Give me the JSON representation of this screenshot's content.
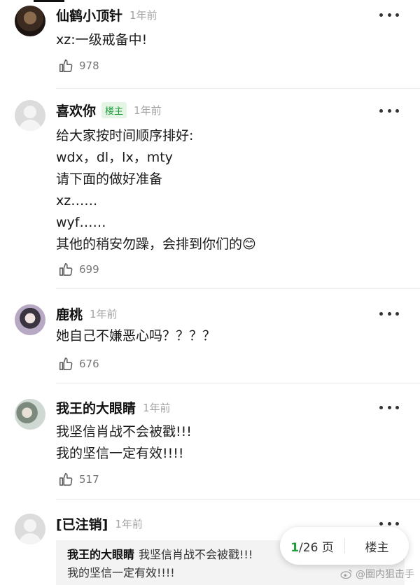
{
  "comments": [
    {
      "name": "仙鹤小顶针",
      "time": "1年前",
      "lines": [
        "xz:一级戒备中!"
      ],
      "likes": "978"
    },
    {
      "name": "喜欢你",
      "badge": "楼主",
      "time": "1年前",
      "lines": [
        "给大家按时间顺序排好:",
        "wdx，dl，lx，mty",
        "请下面的做好准备",
        "xz……",
        "wyf……",
        "其他的稍安勿躁，会排到你们的😊"
      ],
      "likes": "699"
    },
    {
      "name": "鹿桃",
      "time": "1年前",
      "lines": [
        "她自己不嫌恶心吗？？？？"
      ],
      "likes": "676"
    },
    {
      "name": "我王的大眼睛",
      "time": "1年前",
      "lines": [
        "我坚信肖战不会被戳!!!",
        "我的坚信一定有效!!!!"
      ],
      "likes": "517"
    },
    {
      "name": "[已注销]",
      "time": "1年前",
      "quote": {
        "name": "我王的大眼睛",
        "line1": "我坚信肖战不会被戳!!!",
        "line2": "我的坚信一定有效!!!!"
      }
    }
  ],
  "pager": {
    "current": "1",
    "total": "/26 页",
    "louzhu": "楼主"
  },
  "watermark": "@圈内狙击手",
  "icons": {
    "like": "thumbs-up-icon",
    "more": "more-dots-icon"
  }
}
